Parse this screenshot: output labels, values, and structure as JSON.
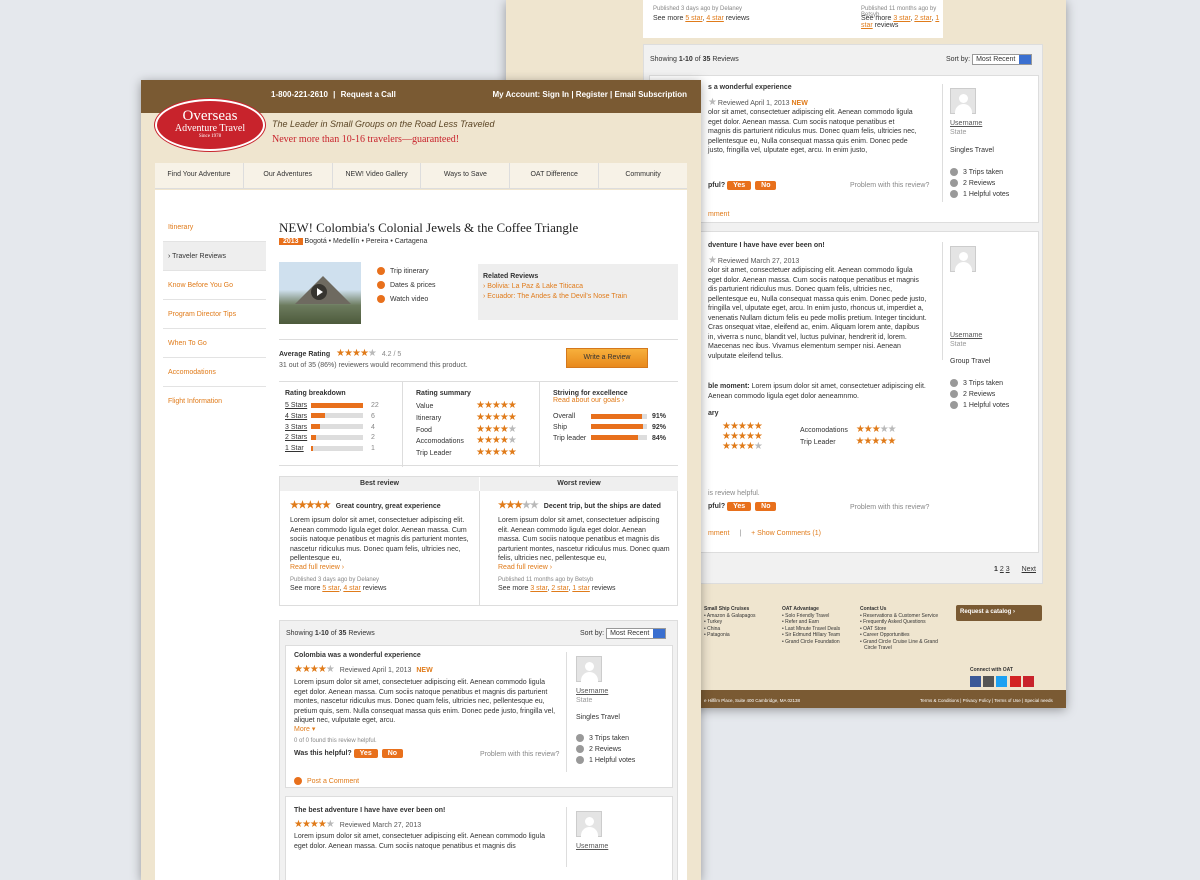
{
  "header": {
    "phone": "1-800-221-2610",
    "request_call": "Request a Call",
    "account_label": "My Account:",
    "sign_in": "Sign In",
    "register": "Register",
    "email_sub": "Email Subscription",
    "logo_line1": "Overseas",
    "logo_line2": "Adventure Travel",
    "logo_since": "Since 1978",
    "tagline": "The Leader in Small Groups on the Road Less Traveled",
    "promise": "Never more than 10-16 travelers—guaranteed!"
  },
  "nav": [
    "Find Your Adventure",
    "Our Adventures",
    "NEW! Video Gallery",
    "Ways to Save",
    "OAT Difference",
    "Community"
  ],
  "sidebar": [
    "Itinerary",
    "Traveler Reviews",
    "Know Before You Go",
    "Program Director Tips",
    "When To Go",
    "Accomodations",
    "Flight Information"
  ],
  "trip": {
    "title": "NEW! Colombia's Colonial Jewels & the Coffee Triangle",
    "year": "2013",
    "places": "Bogotá • Medellín • Pereira • Cartagena",
    "links": [
      "Trip itinerary",
      "Dates & prices",
      "Watch video"
    ],
    "related_title": "Related Reviews",
    "related": [
      "› Bolivia: La Paz & Lake Titicaca",
      "› Ecuador: The Andes & the Devil's Nose Train"
    ]
  },
  "rating": {
    "label": "Average Rating",
    "score": "4.2 / 5",
    "score_value": 4.2,
    "recommend": "31 out of 35 (86%) reviewers would recommend this product.",
    "write_btn": "Write a Review"
  },
  "breakdown": {
    "title": "Rating breakdown",
    "rows": [
      {
        "label": "5 Stars",
        "count": "22",
        "value": 22
      },
      {
        "label": "4 Stars",
        "count": "6",
        "value": 6
      },
      {
        "label": "3 Stars",
        "count": "4",
        "value": 4
      },
      {
        "label": "2 Stars",
        "count": "2",
        "value": 2
      },
      {
        "label": "1 Star",
        "count": "1",
        "value": 1
      }
    ]
  },
  "summary": {
    "title": "Rating summary",
    "rows": [
      {
        "label": "Value",
        "stars": 5
      },
      {
        "label": "Itinerary",
        "stars": 5
      },
      {
        "label": "Food",
        "stars": 4
      },
      {
        "label": "Accomodations",
        "stars": 4
      },
      {
        "label": "Trip Leader",
        "stars": 5
      }
    ]
  },
  "striving": {
    "title": "Striving for excellence",
    "link": "Read about our goals ›",
    "rows": [
      {
        "label": "Overall",
        "pct": "91%",
        "value": 91
      },
      {
        "label": "Ship",
        "pct": "92%",
        "value": 92
      },
      {
        "label": "Trip leader",
        "pct": "84%",
        "value": 84
      }
    ]
  },
  "best": {
    "header": "Best review",
    "stars": 5,
    "title": "Great country, great experience",
    "text": "Lorem ipsum dolor sit amet, consectetuer adipiscing elit. Aenean commodo ligula eget dolor. Aenean massa. Cum sociis natoque penatibus et magnis dis parturient montes, nascetur ridiculus mus. Donec quam felis, ultricies nec, pellentesque eu,",
    "more": "Read full review ›",
    "published": "Published 3 days ago by Delaney",
    "see_more_pre": "See more",
    "see_a": "5 star",
    "see_b": "4 star",
    "see_post": "reviews"
  },
  "worst": {
    "header": "Worst review",
    "stars": 3,
    "title": "Decent trip, but the ships are dated",
    "text": "Lorem ipsum dolor sit amet, consectetuer adipiscing elit. Aenean commodo ligula eget dolor. Aenean massa. Cum sociis natoque penatibus et magnis dis parturient montes, nascetur ridiculus mus. Donec quam felis, ultricies nec, pellentesque eu,",
    "more": "Read full review ›",
    "published": "Published 11 months ago by Betsyb",
    "see_more_pre": "See more",
    "see_a": "3 star",
    "see_b": "2 star",
    "see_c": "1 star",
    "see_post": "reviews"
  },
  "list": {
    "showing_pre": "Showing",
    "showing_range": "1-10",
    "showing_of": "of",
    "showing_total": "35",
    "showing_post": "Reviews",
    "sort_label": "Sort by:",
    "sort_value": "Most Recent"
  },
  "review1": {
    "title": "Colombia was a wonderful experience",
    "stars": 4,
    "date": "Reviewed April 1, 2013",
    "new": "NEW",
    "text": "Lorem ipsum dolor sit amet, consectetuer adipiscing elit. Aenean commodo ligula eget dolor. Aenean massa. Cum sociis natoque penatibus et magnis dis parturient montes, nascetur ridiculus mus. Donec quam felis, ultricies nec, pellentesque eu, pretium quis, sem. Nulla consequat massa quis enim. Donec pede justo, fringilla vel, aliquet nec, vulputate eget, arcu.",
    "more": "More ▾",
    "helpful_count": "0 of 0 found this review helpful.",
    "helpful_q": "Was this helpful?",
    "yes": "Yes",
    "no": "No",
    "problem": "Problem with this review?",
    "post_comment": "Post a Comment",
    "username": "Username",
    "state": "State",
    "traveler_type": "Singles Travel",
    "stats": [
      "3 Trips taken",
      "2 Reviews",
      "1 Helpful votes"
    ]
  },
  "review2": {
    "title": "The best adventure I have have ever been on!",
    "stars": 4,
    "date": "Reviewed March 27, 2013",
    "text": "Lorem ipsum dolor sit amet, consectetuer adipiscing elit. Aenean commodo ligula eget dolor. Aenean massa. Cum sociis natoque penatibus et magnis dis",
    "username": "Username"
  },
  "back": {
    "published_a": "Published 3 days ago by Delaney",
    "published_b": "Published 11 months ago by Betsyb",
    "see_more_pre": "See more",
    "see_a": "5 star",
    "see_b": "4 star",
    "see_c": "3 star",
    "see_d": "2 star",
    "see_e": "1 star",
    "see_post": "reviews",
    "r1_title": "s a wonderful experience",
    "r1_date": "Reviewed April 1, 2013",
    "r1_new": "NEW",
    "r1_text": "olor sit amet, consectetuer adipiscing elit. Aenean commodo ligula eget dolor. Aenean massa. Cum sociis natoque penatibus et magnis dis parturient ridiculus mus. Donec quam felis, ultricies nec, pellentesque eu, Nulla consequat massa quis enim. Donec pede justo, fringilla vel, ulputate eget, arcu. In enim justo,",
    "r1_helpful": "is review helpful.",
    "r1_comment": "mment",
    "r1_helpful_q": "pful?",
    "r2_title": "dventure I have have ever been on!",
    "r2_date": "Reviewed March 27, 2013",
    "r2_text": "olor sit amet, consectetuer adipiscing elit. Aenean commodo ligula eget dolor. Aenean massa. Cum sociis natoque penatibus et magnis dis parturient ridiculus mus. Donec quam felis, ultricies nec, pellentesque eu, Nulla consequat massa quis enim. Donec pede justo, fringilla vel, ulputate eget, arcu. In enim justo, rhoncus ut, imperdiet a, venenatis Nullam dictum felis eu pede mollis pretium. Integer tincidunt. Cras onsequat vitae, eleifend ac, enim. Aliquam lorem ante, dapibus in, viverra s nunc, blandit vel, luctus pulvinar, hendrerit id, lorem. Maecenas nec ibus. Vivamus elementum semper nisi. Aenean vulputate eleifend tellus.",
    "r2_moment_label": "ble moment:",
    "r2_moment": "Lorem ipsum dolor sit amet, consectetuer adipiscing elit. Aenean commodo ligula eget dolor aeneamnmo.",
    "r2_rated": "ary",
    "r2_acc": "Accomodations",
    "r2_tl": "Trip Leader",
    "r2_helpful": "is review helpful.",
    "r2_comment": "mment",
    "r2_show": "+ Show Comments (1)",
    "u2_type": "Group Travel",
    "pages": [
      "1",
      "2",
      "3"
    ],
    "next": "Next",
    "footer_cols": [
      {
        "title": "Small Ship Cruises",
        "items": [
          "• Amazon & Galapagos",
          "• Turkey",
          "• China",
          "• Patagonia"
        ]
      },
      {
        "title": "OAT Advantage",
        "items": [
          "• Solo Friendly Travel",
          "• Refer and Earn",
          "• Last Minute Travel Deals",
          "• Sir Edmund Hillary Team",
          "• Grand Circle Foundation"
        ]
      },
      {
        "title": "Contact Us",
        "items": [
          "• Reservations & Customer Service",
          "• Frequently Asked Questions",
          "• OAT Store",
          "• Career Opportunities",
          "• Grand Circle Cruise Line & Grand",
          "Circle Travel"
        ]
      }
    ],
    "catalog": "Request a catalog ›",
    "connect": "Connect with OAT",
    "address": "e Hilfilm Place, Suite 400 Cambridge, MA 02138",
    "legal": "Terms & Conditions | Privacy Policy | Terms of Use | Special needs"
  }
}
